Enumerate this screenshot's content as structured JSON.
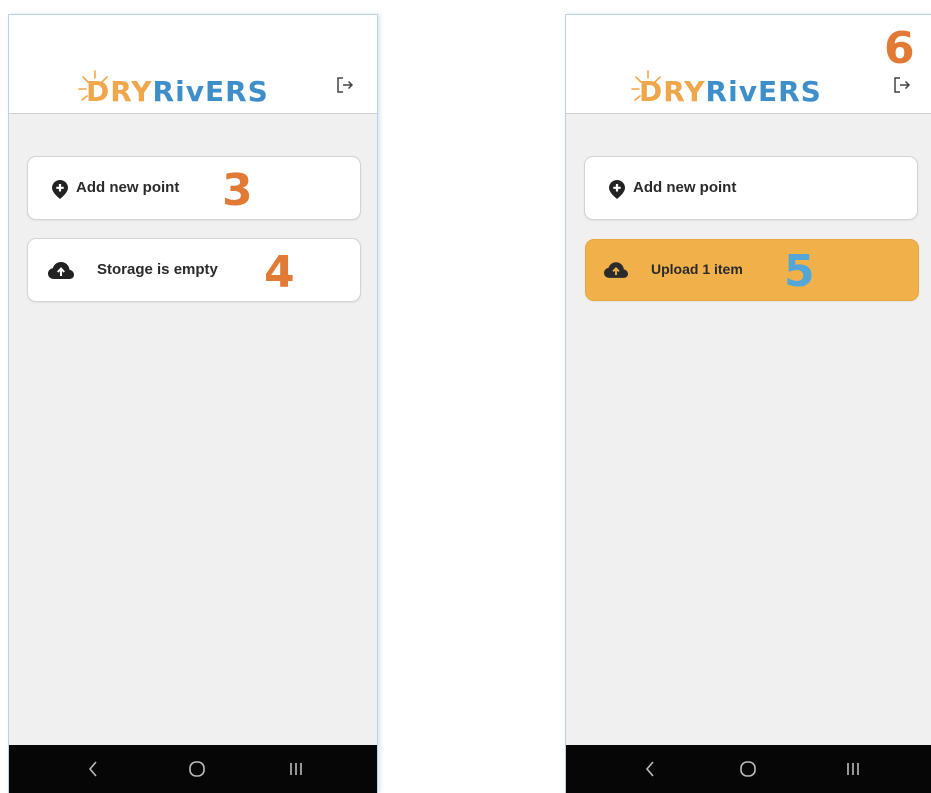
{
  "screens": [
    {
      "logo_text": "DRYRivERS",
      "add_point_label": "Add new point",
      "add_point_icon": "map-marker-plus-icon",
      "storage_label": "Storage is empty",
      "storage_icon": "cloud-upload-icon",
      "logout_icon": "logout-icon",
      "step_add": "3",
      "step_storage": "4"
    },
    {
      "logo_text": "DRYRivERS",
      "add_point_label": "Add new point",
      "add_point_icon": "map-marker-plus-icon",
      "upload_label": "Upload 1 item",
      "upload_icon": "cloud-upload-icon",
      "logout_icon": "logout-icon",
      "step_logout": "6",
      "step_upload": "5"
    }
  ],
  "navbar": {
    "back_icon": "back-chevron-icon",
    "home_icon": "home-circle-icon",
    "recents_icon": "recents-bars-icon"
  },
  "colors": {
    "upload_accent": "#f0b14a",
    "annotation_orange": "#e07a35",
    "annotation_blue": "#52a6d8",
    "logo_orange": "#f0a64a",
    "logo_blue": "#3e8fc9"
  }
}
